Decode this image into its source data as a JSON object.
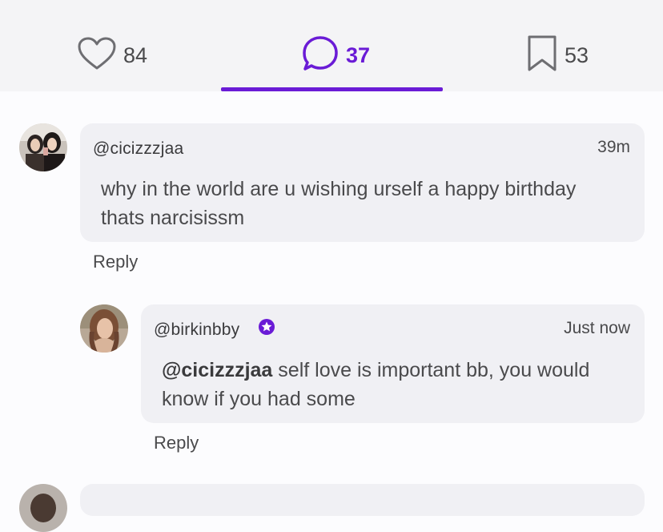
{
  "actions": {
    "likes": "84",
    "comments": "37",
    "saves": "53"
  },
  "comments": [
    {
      "username": "@cicizzzjaa",
      "time": "39m",
      "text": "why in the world are u wishing urself a happy birthday thats narcisissm",
      "reply_label": "Reply"
    },
    {
      "username": "@birkinbby",
      "time": "Just now",
      "mention": "@cicizzzjaa",
      "text": " self love is important bb, you would know if you had some",
      "reply_label": "Reply"
    }
  ],
  "colors": {
    "accent": "#6a1bd6",
    "bubble": "#f0f0f4",
    "bar": "#f4f4f6"
  }
}
